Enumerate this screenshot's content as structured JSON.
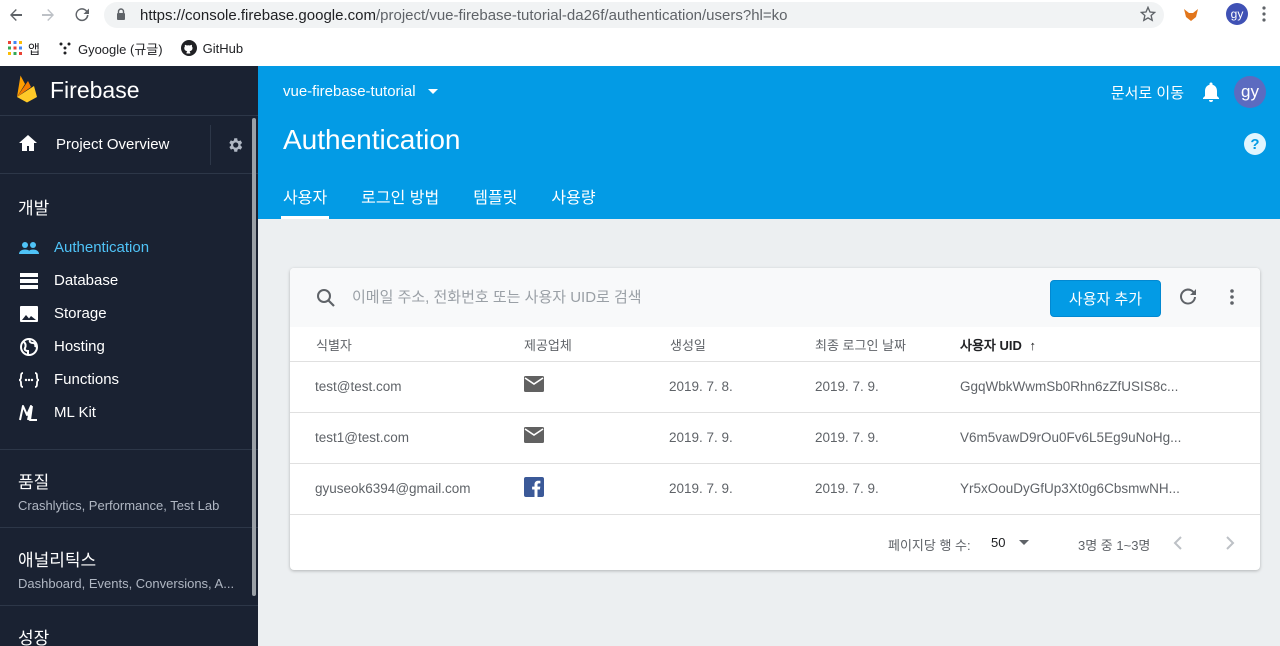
{
  "browser": {
    "url_host": "https://console.firebase.google.com",
    "url_path": "/project/vue-firebase-tutorial-da26f/authentication/users?hl=ko",
    "bookmarks": [
      {
        "label": "앱",
        "icon": "apps-grid-icon"
      },
      {
        "label": "Gyoogle (규글)",
        "icon": "blog-icon"
      },
      {
        "label": "GitHub",
        "icon": "github-icon"
      }
    ],
    "profile_initials": "gy"
  },
  "sidebar": {
    "brand": "Firebase",
    "overview": "Project Overview",
    "section_develop": "개발",
    "items": [
      {
        "label": "Authentication",
        "icon": "people-icon",
        "active": true
      },
      {
        "label": "Database",
        "icon": "database-icon",
        "active": false
      },
      {
        "label": "Storage",
        "icon": "image-icon",
        "active": false
      },
      {
        "label": "Hosting",
        "icon": "globe-icon",
        "active": false
      },
      {
        "label": "Functions",
        "icon": "functions-icon",
        "active": false
      },
      {
        "label": "ML Kit",
        "icon": "ml-kit-icon",
        "active": false
      }
    ],
    "groups": [
      {
        "title": "품질",
        "subtitle": "Crashlytics, Performance, Test Lab"
      },
      {
        "title": "애널리틱스",
        "subtitle": "Dashboard, Events, Conversions, A..."
      },
      {
        "title": "성장",
        "subtitle": ""
      }
    ]
  },
  "header": {
    "project": "vue-firebase-tutorial",
    "docs_link": "문서로 이동",
    "avatar": "gy",
    "title": "Authentication",
    "tabs": [
      "사용자",
      "로그인 방법",
      "템플릿",
      "사용량"
    ]
  },
  "users": {
    "search_placeholder": "이메일 주소, 전화번호 또는 사용자 UID로 검색",
    "add_button": "사용자 추가",
    "columns": [
      "식별자",
      "제공업체",
      "생성일",
      "최종 로그인 날짜",
      "사용자 UID"
    ],
    "sort_arrow": "↑",
    "rows": [
      {
        "id": "test@test.com",
        "provider": "email",
        "created": "2019. 7. 8.",
        "last_login": "2019. 7. 9.",
        "uid": "GgqWbkWwmSb0Rhn6zZfUSIS8c..."
      },
      {
        "id": "test1@test.com",
        "provider": "email",
        "created": "2019. 7. 9.",
        "last_login": "2019. 7. 9.",
        "uid": "V6m5vawD9rOu0Fv6L5Eg9uNoHg..."
      },
      {
        "id": "gyuseok6394@gmail.com",
        "provider": "facebook",
        "created": "2019. 7. 9.",
        "last_login": "2019. 7. 9.",
        "uid": "Yr5xOouDyGfUp3Xt0g6CbsmwNH..."
      }
    ],
    "rows_per_page_label": "페이지당 행 수:",
    "rows_per_page": "50",
    "range": "3명 중 1~3명"
  },
  "colors": {
    "header_bg": "#039be5",
    "sidebar_bg": "#1a2232",
    "active_item": "#4fc3f7",
    "facebook": "#3b5998"
  }
}
